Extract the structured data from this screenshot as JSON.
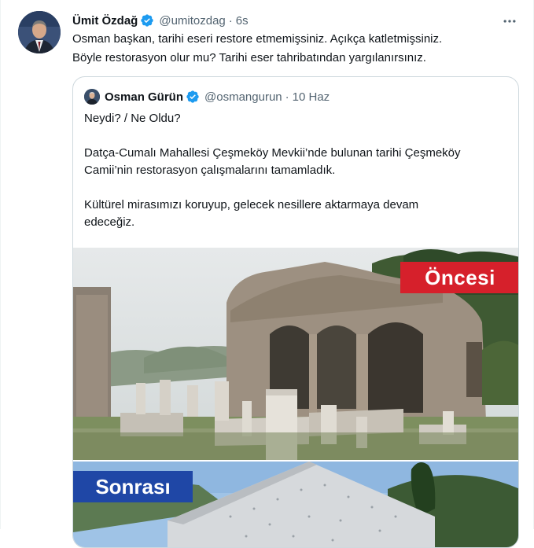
{
  "tweet": {
    "author_name": "Ümit Özdağ",
    "handle": "@umitozdag",
    "separator": "·",
    "time": "6s",
    "text_lines": [
      "Osman başkan, tarihi eseri restore etmemişsiniz. Açıkça katletmişsiniz.",
      "Böyle restorasyon olur mu? Tarihi eser tahribatından yargılanırsınız."
    ]
  },
  "quoted_tweet": {
    "author_name": "Osman Gürün",
    "handle": "@osmangurun",
    "separator": "·",
    "time": "10 Haz",
    "paragraphs": [
      [
        "Neydi? / Ne Oldu?"
      ],
      [
        "Datça-Cumalı Mahallesi Çeşmeköy Mevkii’nde bulunan tarihi Çeşmeköy",
        "Camii’nin restorasyon çalışmalarını tamamladık."
      ],
      [
        "Kültürel mirasımızı koruyup, gelecek nesillere aktarmaya devam",
        "edeceğiz."
      ]
    ],
    "image_labels": {
      "before": "Öncesi",
      "after": "Sonrası"
    }
  },
  "colors": {
    "verified": "#1d9bf0",
    "muted_text": "#536471",
    "border": "#cfd9de",
    "label_before_bg": "#d6202b",
    "label_after_bg": "#1f47a6"
  },
  "icons": [
    "verified-badge-icon",
    "more-options-icon"
  ]
}
